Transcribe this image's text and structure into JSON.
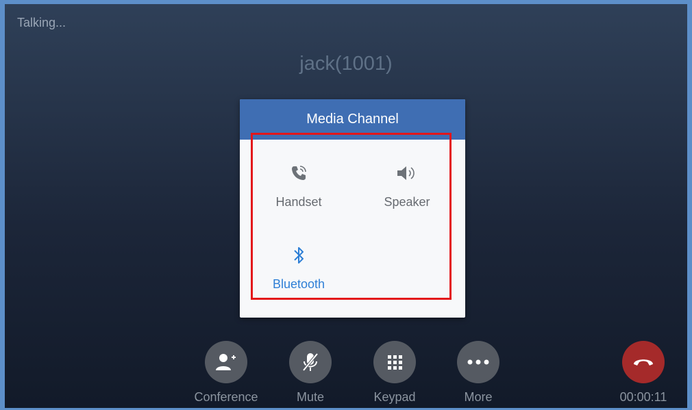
{
  "status": {
    "text": "Talking..."
  },
  "caller": {
    "name": "jack(1001)"
  },
  "dialog": {
    "title": "Media Channel",
    "options": [
      {
        "label": "Handset",
        "icon": "handset-icon"
      },
      {
        "label": "Speaker",
        "icon": "speaker-icon"
      },
      {
        "label": "Bluetooth",
        "icon": "bluetooth-icon",
        "selected": true
      }
    ]
  },
  "call_actions": [
    {
      "label": "Conference",
      "icon": "add-person-icon"
    },
    {
      "label": "Mute",
      "icon": "mic-off-icon"
    },
    {
      "label": "Keypad",
      "icon": "keypad-icon"
    },
    {
      "label": "More",
      "icon": "more-icon"
    }
  ],
  "call_timer": "00:00:11",
  "colors": {
    "accent": "#3f6eb3",
    "selected": "#2e7fd6",
    "end_call": "#a52a2a",
    "highlight_box": "#e3161a"
  }
}
